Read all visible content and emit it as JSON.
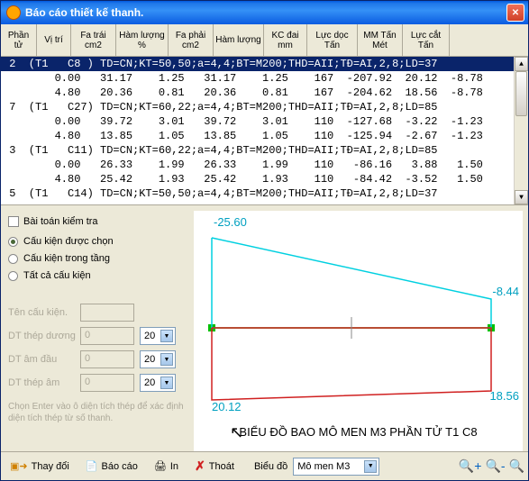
{
  "window": {
    "title": "Báo cáo thiết kế thanh."
  },
  "cols": {
    "c1": "Phần tử",
    "c2": "Vị trí",
    "c3": "Fa trái cm2",
    "c4": "Hàm lượng %",
    "c5": "Fa phải cm2",
    "c6": "Hàm lượng",
    "c7": "KC đai mm",
    "c8": "Lực dọc Tấn",
    "c9": "MM Tấn Mét",
    "c10": "Lực cắt Tấn"
  },
  "rows": [
    " 2  (T1   C8 ) TD=CN;KT=50,50;a=4,4;BT=M200;THD=AII;TĐ=AI,2,8;LD=37",
    "        0.00   31.17    1.25   31.17    1.25    167  -207.92  20.12  -8.78",
    "        4.80   20.36    0.81   20.36    0.81    167  -204.62  18.56  -8.78",
    " 7  (T1   C27) TD=CN;KT=60,22;a=4,4;BT=M200;THD=AII;TĐ=AI,2,8;LD=85",
    "        0.00   39.72    3.01   39.72    3.01    110  -127.68  -3.22  -1.23",
    "        4.80   13.85    1.05   13.85    1.05    110  -125.94  -2.67  -1.23",
    " 3  (T1   C11) TD=CN;KT=60,22;a=4,4;BT=M200;THD=AII;TĐ=AI,2,8;LD=85",
    "        0.00   26.33    1.99   26.33    1.99    110   -86.16   3.88   1.50",
    "        4.80   25.42    1.93   25.42    1.93    110   -84.42  -3.52   1.50",
    " 5  (T1   C14) TD=CN;KT=50,50;a=4,4;BT=M200;THD=AII;TĐ=AI,2,8;LD=37"
  ],
  "controls": {
    "check": "Bài toán kiểm tra",
    "r1": "Cấu kiện được chọn",
    "r2": "Cấu kiện trong tầng",
    "r3": "Tất cả cấu kiện",
    "f1": "Tên cấu kiện.",
    "f1v": "",
    "f2": "DT thép dương",
    "f2v": "0",
    "s20": "20",
    "f3": "DT âm đầu",
    "f3v": "0",
    "f4": "DT thép âm",
    "f4v": "0",
    "hint": "Chọn Enter vào ô diện tích thép để xác định diện tích thép từ số thanh."
  },
  "chart_data": {
    "type": "line",
    "xlabel": "",
    "ylabel": "",
    "title": "BIỂU ĐỒ BAO MÔ MEN M3 PHẦN TỬ T1  C8",
    "labels": {
      "tl": "-25.60",
      "tr": "-8.44",
      "bl": "20.12",
      "br": "18.56"
    },
    "series": [
      {
        "name": "upper",
        "color": "#00d0e0",
        "x": [
          0,
          1
        ],
        "y": [
          -25.6,
          -8.44
        ]
      },
      {
        "name": "lower",
        "color": "#d02020",
        "x": [
          0,
          1
        ],
        "y": [
          20.12,
          18.56
        ]
      }
    ],
    "ylim": [
      -30,
      25
    ]
  },
  "bottom": {
    "b1": "Thay đổi",
    "b2": "Báo cáo",
    "b3": "In",
    "b4": "Thoát",
    "sel_lbl": "Biểu đồ",
    "sel_val": "Mô men M3"
  }
}
